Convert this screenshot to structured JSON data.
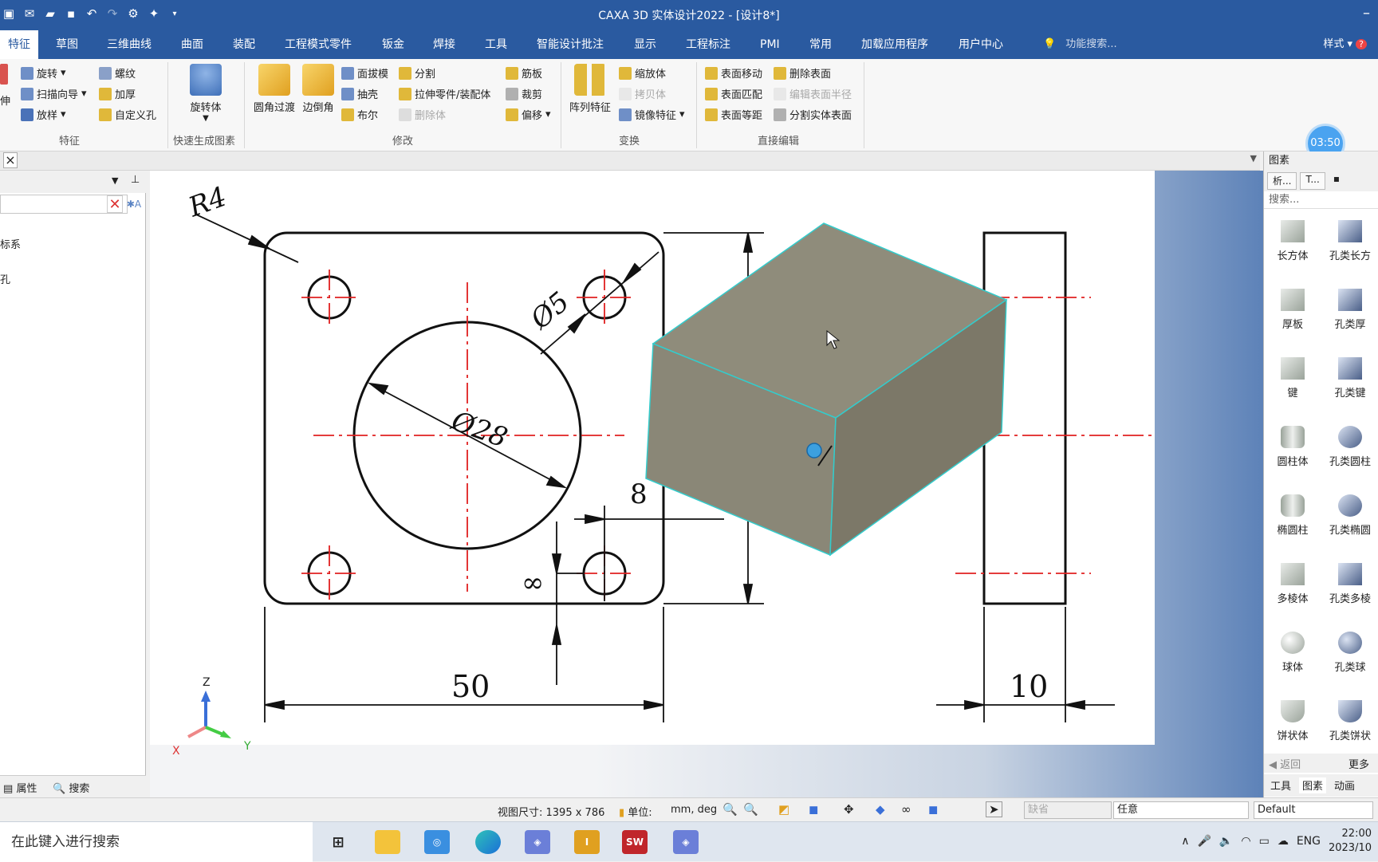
{
  "app": {
    "title": "CAXA 3D 实体设计2022 - [设计8*]",
    "minimize": "–"
  },
  "quick_access": [
    "new-icon",
    "mail-icon",
    "open-icon",
    "save-icon",
    "undo-icon",
    "redo-icon",
    "tool-icon",
    "sparkle-icon",
    "dropdown-icon"
  ],
  "menu": {
    "tabs": [
      "特征",
      "草图",
      "三维曲线",
      "曲面",
      "装配",
      "工程模式零件",
      "钣金",
      "焊接",
      "工具",
      "智能设计批注",
      "显示",
      "工程标注",
      "PMI",
      "常用",
      "加载应用程序",
      "用户中心"
    ],
    "search_placeholder": "功能搜索...",
    "style_label": "样式"
  },
  "ribbon": {
    "feature_group": {
      "label": "特征",
      "items": [
        "旋转",
        "扫描向导",
        "放样",
        "螺纹",
        "加厚",
        "自定义孔"
      ],
      "partial": "伸"
    },
    "quick_group": {
      "label": "快速生成图素",
      "item": "旋转体"
    },
    "modify_group": {
      "label": "修改",
      "big": [
        "圆角过渡",
        "边倒角"
      ],
      "items": [
        "面拔模",
        "抽壳",
        "布尔",
        "分割",
        "拉伸零件/装配体",
        "删除体",
        "筋板",
        "裁剪",
        "偏移"
      ]
    },
    "transform_group": {
      "label": "变换",
      "big": "阵列特征",
      "items": [
        "缩放体",
        "拷贝体",
        "镜像特征"
      ]
    },
    "direct_group": {
      "label": "直接编辑",
      "items": [
        "表面移动",
        "表面匹配",
        "表面等距",
        "删除表面",
        "编辑表面半径",
        "分割实体表面"
      ]
    },
    "clock": "03:50"
  },
  "left_panel": {
    "items": [
      "标系",
      "孔"
    ],
    "footer": {
      "properties": "属性",
      "search": "搜索"
    }
  },
  "drawing": {
    "dims": {
      "r4": "R4",
      "phi5": "Ø5",
      "phi28": "Ø28",
      "eight": "8",
      "infinity": "∞",
      "fifty": "50",
      "ten": "10"
    },
    "triad": {
      "z": "Z",
      "x": "X",
      "y": "Y"
    }
  },
  "right_panel": {
    "header": "图素",
    "tabs": [
      "析...",
      "T..."
    ],
    "search": "搜索...",
    "shapes": [
      "长方体",
      "孔类长方",
      "厚板",
      "孔类厚",
      "键",
      "孔类键",
      "圆柱体",
      "孔类圆柱",
      "椭圆柱",
      "孔类椭圆",
      "多棱体",
      "孔类多棱",
      "球体",
      "孔类球",
      "饼状体",
      "孔类饼状"
    ],
    "back": "返回",
    "more": "更多",
    "bottom_tabs": [
      "工具",
      "图素",
      "动画"
    ]
  },
  "status": {
    "view_size": "视图尺寸: 1395 x  786",
    "unit_label": "单位:",
    "unit_value": "mm, deg",
    "dropdown1": "缺省",
    "dropdown2": "任意",
    "dropdown3": "Default"
  },
  "taskbar": {
    "search": "在此键入进行搜索",
    "tray_lang": "ENG",
    "time": "22:00",
    "date": "2023/10"
  }
}
